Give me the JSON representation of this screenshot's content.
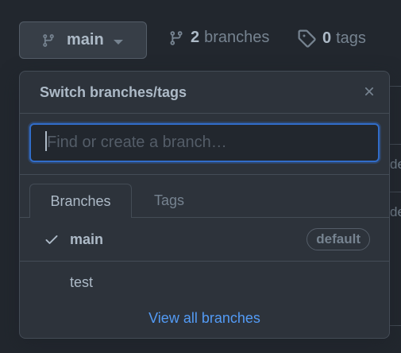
{
  "branch_button": {
    "label": "main",
    "icon": "git-branch-icon"
  },
  "stats": {
    "branches_count": "2",
    "branches_label": "branches",
    "tags_count": "0",
    "tags_label": "tags"
  },
  "background": {
    "row_texts": [
      "de",
      "de"
    ]
  },
  "dropdown": {
    "title": "Switch branches/tags",
    "filter_placeholder": "Find or create a branch…",
    "filter_value": "",
    "tabs": [
      {
        "label": "Branches",
        "active": true
      },
      {
        "label": "Tags",
        "active": false
      }
    ],
    "items": [
      {
        "name": "main",
        "selected": true,
        "badge": "default"
      },
      {
        "name": "test",
        "selected": false,
        "badge": ""
      }
    ],
    "view_all": "View all branches"
  },
  "colors": {
    "background": "#22272e",
    "panel": "#2d333b",
    "border": "#444c56",
    "accent_link": "#539bf5",
    "focus_border": "#316dca"
  }
}
